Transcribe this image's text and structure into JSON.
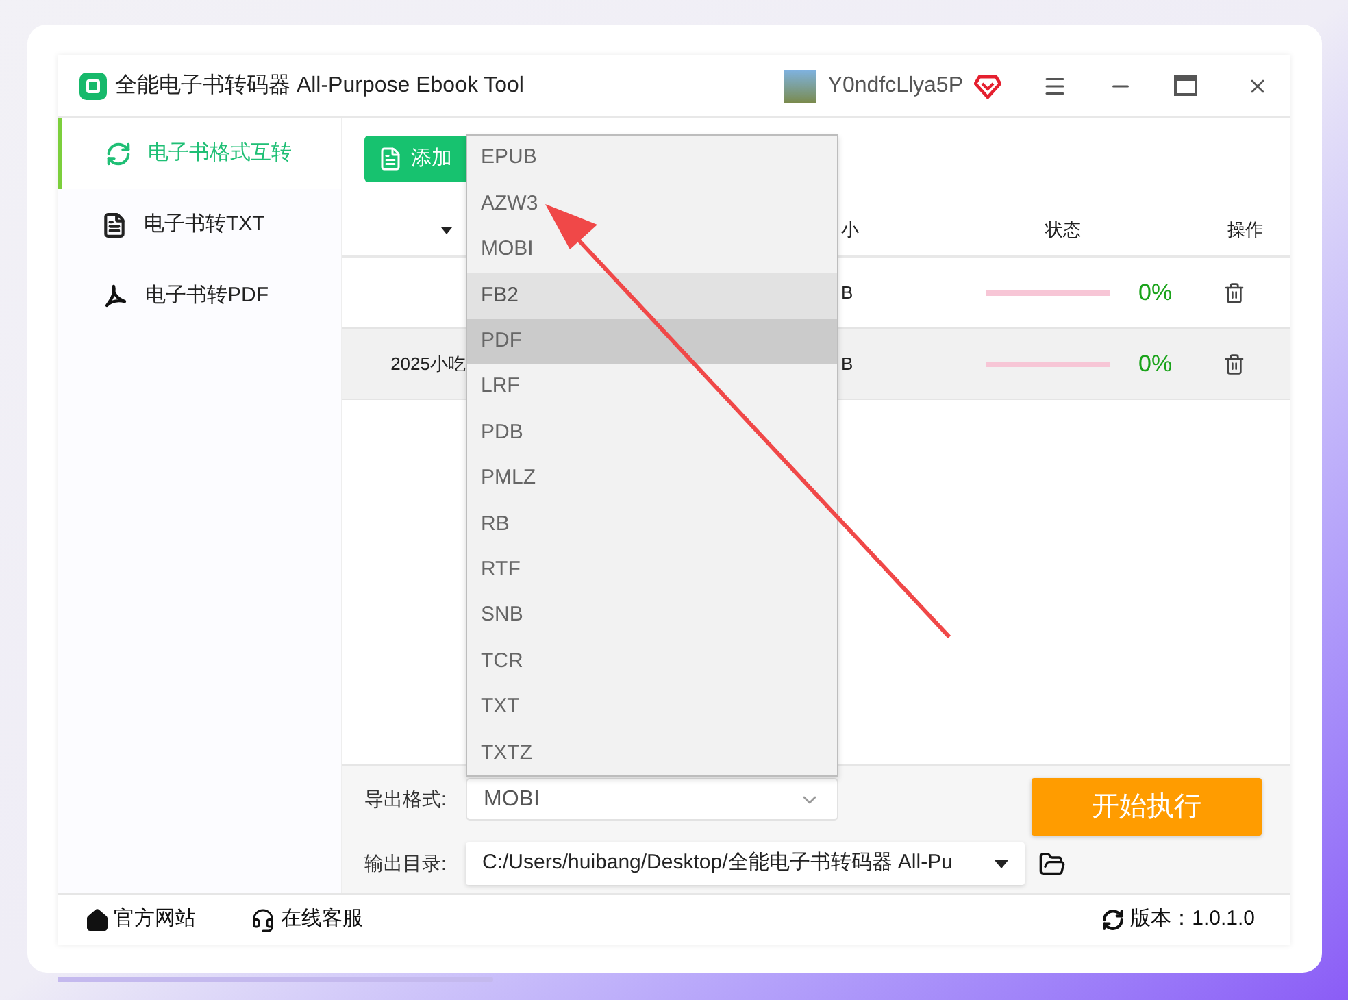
{
  "window": {
    "title": "全能电子书转码器 All-Purpose Ebook Tool",
    "username": "Y0ndfcLlya5P"
  },
  "sidebar": {
    "items": [
      {
        "label": "电子书格式互转",
        "selected": true
      },
      {
        "label": "电子书转TXT",
        "selected": false
      },
      {
        "label": "电子书转PDF",
        "selected": false
      }
    ]
  },
  "toolbar": {
    "add_button": "添加"
  },
  "table": {
    "columns": [
      "小",
      "状态",
      "操作"
    ],
    "rows": [
      {
        "name": "",
        "size": "B",
        "level": 0,
        "percent": "0%",
        "selected": false
      },
      {
        "name": "2025小吃",
        "size": "B",
        "level": 0,
        "percent": "0%",
        "selected": true
      }
    ]
  },
  "dropdown": {
    "options": [
      {
        "label": "EPUB",
        "hovered": false,
        "selected": false
      },
      {
        "label": "AZW3",
        "hovered": false,
        "selected": false
      },
      {
        "label": "MOBI",
        "hovered": false,
        "selected": false
      },
      {
        "label": "FB2",
        "hovered": true,
        "selected": false
      },
      {
        "label": "PDF",
        "hovered": false,
        "selected": true
      },
      {
        "label": "LRF",
        "hovered": false,
        "selected": false
      },
      {
        "label": "PDB",
        "hovered": false,
        "selected": false
      },
      {
        "label": "PMLZ",
        "hovered": false,
        "selected": false
      },
      {
        "label": "RB",
        "hovered": false,
        "selected": false
      },
      {
        "label": "RTF",
        "hovered": false,
        "selected": false
      },
      {
        "label": "SNB",
        "hovered": false,
        "selected": false
      },
      {
        "label": "TCR",
        "hovered": false,
        "selected": false
      },
      {
        "label": "TXT",
        "hovered": false,
        "selected": false
      },
      {
        "label": "TXTZ",
        "hovered": false,
        "selected": false
      }
    ]
  },
  "settings": {
    "format_label": "导出格式:",
    "format_value": "MOBI",
    "dir_label": "输出目录:",
    "dir_value": "C:/Users/huibang/Desktop/全能电子书转码器 All-Pu",
    "start_button": "开始执行"
  },
  "footer": {
    "website": "官方网站",
    "support": "在线客服",
    "version": "版本：1.0.1.0"
  }
}
